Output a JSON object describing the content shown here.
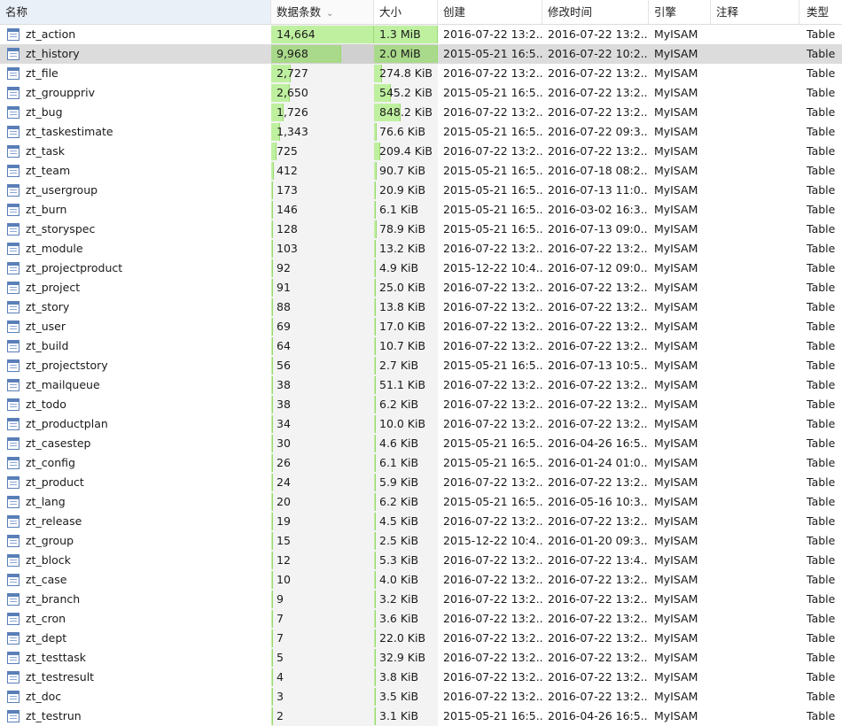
{
  "columns": {
    "name": "名称",
    "rows": "数据条数",
    "size": "大小",
    "created": "创建",
    "modified": "修改时间",
    "engine": "引擎",
    "comment": "注释",
    "type": "类型"
  },
  "sort_icon": "chevron-down-icon",
  "bar_color": "#bff0a0",
  "selected_index": 1,
  "tables": [
    {
      "name": "zt_action",
      "rows": "14,664",
      "size": "1.3 MiB",
      "created": "2016-07-22 13:2...",
      "modified": "2016-07-22 13:2...",
      "engine": "MyISAM",
      "comment": "",
      "type": "Table",
      "rows_frac": 1.0,
      "size_frac": 1.0
    },
    {
      "name": "zt_history",
      "rows": "9,968",
      "size": "2.0 MiB",
      "created": "2015-05-21 16:5...",
      "modified": "2016-07-22 10:2...",
      "engine": "MyISAM",
      "comment": "",
      "type": "Table",
      "rows_frac": 0.68,
      "size_frac": 1.0
    },
    {
      "name": "zt_file",
      "rows": "2,727",
      "size": "274.8 KiB",
      "created": "2016-07-22 13:2...",
      "modified": "2016-07-22 13:2...",
      "engine": "MyISAM",
      "comment": "",
      "type": "Table",
      "rows_frac": 0.19,
      "size_frac": 0.13
    },
    {
      "name": "zt_grouppriv",
      "rows": "2,650",
      "size": "545.2 KiB",
      "created": "2015-05-21 16:5...",
      "modified": "2016-07-22 13:2...",
      "engine": "MyISAM",
      "comment": "",
      "type": "Table",
      "rows_frac": 0.18,
      "size_frac": 0.27
    },
    {
      "name": "zt_bug",
      "rows": "1,726",
      "size": "848.2 KiB",
      "created": "2016-07-22 13:2...",
      "modified": "2016-07-22 13:2...",
      "engine": "MyISAM",
      "comment": "",
      "type": "Table",
      "rows_frac": 0.12,
      "size_frac": 0.41
    },
    {
      "name": "zt_taskestimate",
      "rows": "1,343",
      "size": "76.6 KiB",
      "created": "2015-05-21 16:5...",
      "modified": "2016-07-22 09:3...",
      "engine": "MyISAM",
      "comment": "",
      "type": "Table",
      "rows_frac": 0.09,
      "size_frac": 0.04
    },
    {
      "name": "zt_task",
      "rows": "725",
      "size": "209.4 KiB",
      "created": "2016-07-22 13:2...",
      "modified": "2016-07-22 13:2...",
      "engine": "MyISAM",
      "comment": "",
      "type": "Table",
      "rows_frac": 0.05,
      "size_frac": 0.1
    },
    {
      "name": "zt_team",
      "rows": "412",
      "size": "90.7 KiB",
      "created": "2015-05-21 16:5...",
      "modified": "2016-07-18 08:2...",
      "engine": "MyISAM",
      "comment": "",
      "type": "Table",
      "rows_frac": 0.03,
      "size_frac": 0.04
    },
    {
      "name": "zt_usergroup",
      "rows": "173",
      "size": "20.9 KiB",
      "created": "2015-05-21 16:5...",
      "modified": "2016-07-13 11:0...",
      "engine": "MyISAM",
      "comment": "",
      "type": "Table",
      "rows_frac": 0.01,
      "size_frac": 0.01
    },
    {
      "name": "zt_burn",
      "rows": "146",
      "size": "6.1 KiB",
      "created": "2015-05-21 16:5...",
      "modified": "2016-03-02 16:3...",
      "engine": "MyISAM",
      "comment": "",
      "type": "Table",
      "rows_frac": 0.01,
      "size_frac": 0.0
    },
    {
      "name": "zt_storyspec",
      "rows": "128",
      "size": "78.9 KiB",
      "created": "2015-05-21 16:5...",
      "modified": "2016-07-13 09:0...",
      "engine": "MyISAM",
      "comment": "",
      "type": "Table",
      "rows_frac": 0.01,
      "size_frac": 0.04
    },
    {
      "name": "zt_module",
      "rows": "103",
      "size": "13.2 KiB",
      "created": "2016-07-22 13:2...",
      "modified": "2016-07-22 13:2...",
      "engine": "MyISAM",
      "comment": "",
      "type": "Table",
      "rows_frac": 0.01,
      "size_frac": 0.01
    },
    {
      "name": "zt_projectproduct",
      "rows": "92",
      "size": "4.9 KiB",
      "created": "2015-12-22 10:4...",
      "modified": "2016-07-12 09:0...",
      "engine": "MyISAM",
      "comment": "",
      "type": "Table",
      "rows_frac": 0.01,
      "size_frac": 0.0
    },
    {
      "name": "zt_project",
      "rows": "91",
      "size": "25.0 KiB",
      "created": "2016-07-22 13:2...",
      "modified": "2016-07-22 13:2...",
      "engine": "MyISAM",
      "comment": "",
      "type": "Table",
      "rows_frac": 0.01,
      "size_frac": 0.01
    },
    {
      "name": "zt_story",
      "rows": "88",
      "size": "13.8 KiB",
      "created": "2016-07-22 13:2...",
      "modified": "2016-07-22 13:2...",
      "engine": "MyISAM",
      "comment": "",
      "type": "Table",
      "rows_frac": 0.01,
      "size_frac": 0.01
    },
    {
      "name": "zt_user",
      "rows": "69",
      "size": "17.0 KiB",
      "created": "2016-07-22 13:2...",
      "modified": "2016-07-22 13:2...",
      "engine": "MyISAM",
      "comment": "",
      "type": "Table",
      "rows_frac": 0.0,
      "size_frac": 0.01
    },
    {
      "name": "zt_build",
      "rows": "64",
      "size": "10.7 KiB",
      "created": "2016-07-22 13:2...",
      "modified": "2016-07-22 13:2...",
      "engine": "MyISAM",
      "comment": "",
      "type": "Table",
      "rows_frac": 0.0,
      "size_frac": 0.01
    },
    {
      "name": "zt_projectstory",
      "rows": "56",
      "size": "2.7 KiB",
      "created": "2015-05-21 16:5...",
      "modified": "2016-07-13 10:5...",
      "engine": "MyISAM",
      "comment": "",
      "type": "Table",
      "rows_frac": 0.0,
      "size_frac": 0.0
    },
    {
      "name": "zt_mailqueue",
      "rows": "38",
      "size": "51.1 KiB",
      "created": "2016-07-22 13:2...",
      "modified": "2016-07-22 13:2...",
      "engine": "MyISAM",
      "comment": "",
      "type": "Table",
      "rows_frac": 0.0,
      "size_frac": 0.02
    },
    {
      "name": "zt_todo",
      "rows": "38",
      "size": "6.2 KiB",
      "created": "2016-07-22 13:2...",
      "modified": "2016-07-22 13:2...",
      "engine": "MyISAM",
      "comment": "",
      "type": "Table",
      "rows_frac": 0.0,
      "size_frac": 0.0
    },
    {
      "name": "zt_productplan",
      "rows": "34",
      "size": "10.0 KiB",
      "created": "2016-07-22 13:2...",
      "modified": "2016-07-22 13:2...",
      "engine": "MyISAM",
      "comment": "",
      "type": "Table",
      "rows_frac": 0.0,
      "size_frac": 0.0
    },
    {
      "name": "zt_casestep",
      "rows": "30",
      "size": "4.6 KiB",
      "created": "2015-05-21 16:5...",
      "modified": "2016-04-26 16:5...",
      "engine": "MyISAM",
      "comment": "",
      "type": "Table",
      "rows_frac": 0.0,
      "size_frac": 0.0
    },
    {
      "name": "zt_config",
      "rows": "26",
      "size": "6.1 KiB",
      "created": "2015-05-21 16:5...",
      "modified": "2016-01-24 01:0...",
      "engine": "MyISAM",
      "comment": "",
      "type": "Table",
      "rows_frac": 0.0,
      "size_frac": 0.0
    },
    {
      "name": "zt_product",
      "rows": "24",
      "size": "5.9 KiB",
      "created": "2016-07-22 13:2...",
      "modified": "2016-07-22 13:2...",
      "engine": "MyISAM",
      "comment": "",
      "type": "Table",
      "rows_frac": 0.0,
      "size_frac": 0.0
    },
    {
      "name": "zt_lang",
      "rows": "20",
      "size": "6.2 KiB",
      "created": "2015-05-21 16:5...",
      "modified": "2016-05-16 10:3...",
      "engine": "MyISAM",
      "comment": "",
      "type": "Table",
      "rows_frac": 0.0,
      "size_frac": 0.0
    },
    {
      "name": "zt_release",
      "rows": "19",
      "size": "4.5 KiB",
      "created": "2016-07-22 13:2...",
      "modified": "2016-07-22 13:2...",
      "engine": "MyISAM",
      "comment": "",
      "type": "Table",
      "rows_frac": 0.0,
      "size_frac": 0.0
    },
    {
      "name": "zt_group",
      "rows": "15",
      "size": "2.5 KiB",
      "created": "2015-12-22 10:4...",
      "modified": "2016-01-20 09:3...",
      "engine": "MyISAM",
      "comment": "",
      "type": "Table",
      "rows_frac": 0.0,
      "size_frac": 0.0
    },
    {
      "name": "zt_block",
      "rows": "12",
      "size": "5.3 KiB",
      "created": "2016-07-22 13:2...",
      "modified": "2016-07-22 13:4...",
      "engine": "MyISAM",
      "comment": "",
      "type": "Table",
      "rows_frac": 0.0,
      "size_frac": 0.0
    },
    {
      "name": "zt_case",
      "rows": "10",
      "size": "4.0 KiB",
      "created": "2016-07-22 13:2...",
      "modified": "2016-07-22 13:2...",
      "engine": "MyISAM",
      "comment": "",
      "type": "Table",
      "rows_frac": 0.0,
      "size_frac": 0.0
    },
    {
      "name": "zt_branch",
      "rows": "9",
      "size": "3.2 KiB",
      "created": "2016-07-22 13:2...",
      "modified": "2016-07-22 13:2...",
      "engine": "MyISAM",
      "comment": "",
      "type": "Table",
      "rows_frac": 0.0,
      "size_frac": 0.0
    },
    {
      "name": "zt_cron",
      "rows": "7",
      "size": "3.6 KiB",
      "created": "2016-07-22 13:2...",
      "modified": "2016-07-22 13:2...",
      "engine": "MyISAM",
      "comment": "",
      "type": "Table",
      "rows_frac": 0.0,
      "size_frac": 0.0
    },
    {
      "name": "zt_dept",
      "rows": "7",
      "size": "22.0 KiB",
      "created": "2016-07-22 13:2...",
      "modified": "2016-07-22 13:2...",
      "engine": "MyISAM",
      "comment": "",
      "type": "Table",
      "rows_frac": 0.0,
      "size_frac": 0.01
    },
    {
      "name": "zt_testtask",
      "rows": "5",
      "size": "32.9 KiB",
      "created": "2016-07-22 13:2...",
      "modified": "2016-07-22 13:2...",
      "engine": "MyISAM",
      "comment": "",
      "type": "Table",
      "rows_frac": 0.0,
      "size_frac": 0.02
    },
    {
      "name": "zt_testresult",
      "rows": "4",
      "size": "3.8 KiB",
      "created": "2016-07-22 13:2...",
      "modified": "2016-07-22 13:2...",
      "engine": "MyISAM",
      "comment": "",
      "type": "Table",
      "rows_frac": 0.0,
      "size_frac": 0.0
    },
    {
      "name": "zt_doc",
      "rows": "3",
      "size": "3.5 KiB",
      "created": "2016-07-22 13:2...",
      "modified": "2016-07-22 13:2...",
      "engine": "MyISAM",
      "comment": "",
      "type": "Table",
      "rows_frac": 0.0,
      "size_frac": 0.0
    },
    {
      "name": "zt_testrun",
      "rows": "2",
      "size": "3.1 KiB",
      "created": "2015-05-21 16:5...",
      "modified": "2016-04-26 16:5...",
      "engine": "MyISAM",
      "comment": "",
      "type": "Table",
      "rows_frac": 0.0,
      "size_frac": 0.0
    }
  ]
}
